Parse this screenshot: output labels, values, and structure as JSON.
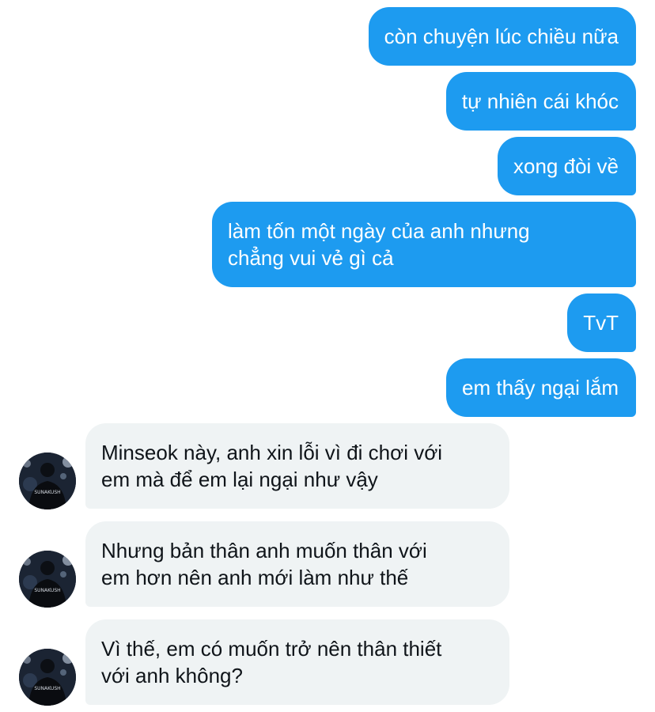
{
  "conversation": {
    "sent": [
      {
        "lines": [
          "còn chuyện lúc chiều nữa"
        ]
      },
      {
        "lines": [
          "tự nhiên cái khóc"
        ]
      },
      {
        "lines": [
          "xong đòi về"
        ]
      },
      {
        "lines": [
          "làm tốn một ngày của anh nhưng",
          "chẳng vui vẻ gì cả"
        ]
      },
      {
        "lines": [
          "TvT"
        ]
      },
      {
        "lines": [
          "em thấy ngại lắm"
        ]
      }
    ],
    "received": [
      {
        "lines": [
          "Minseok này, anh xin lỗi vì đi chơi với",
          "em mà để em lại ngại như vậy"
        ]
      },
      {
        "lines": [
          "Nhưng bản thân anh muốn thân với",
          "em hơn nên anh mới làm như thế"
        ]
      },
      {
        "lines": [
          "Vì thế, em có muốn trở nên thân thiết",
          "với anh không?"
        ]
      }
    ]
  },
  "colors": {
    "sent_bubble": "#1d9bf0",
    "received_bubble": "#eff3f4",
    "sent_text": "#ffffff",
    "received_text": "#0f1419"
  },
  "avatar": {
    "icon": "profile-photo-avatar",
    "jacket_text": "SUNAKUSH"
  }
}
